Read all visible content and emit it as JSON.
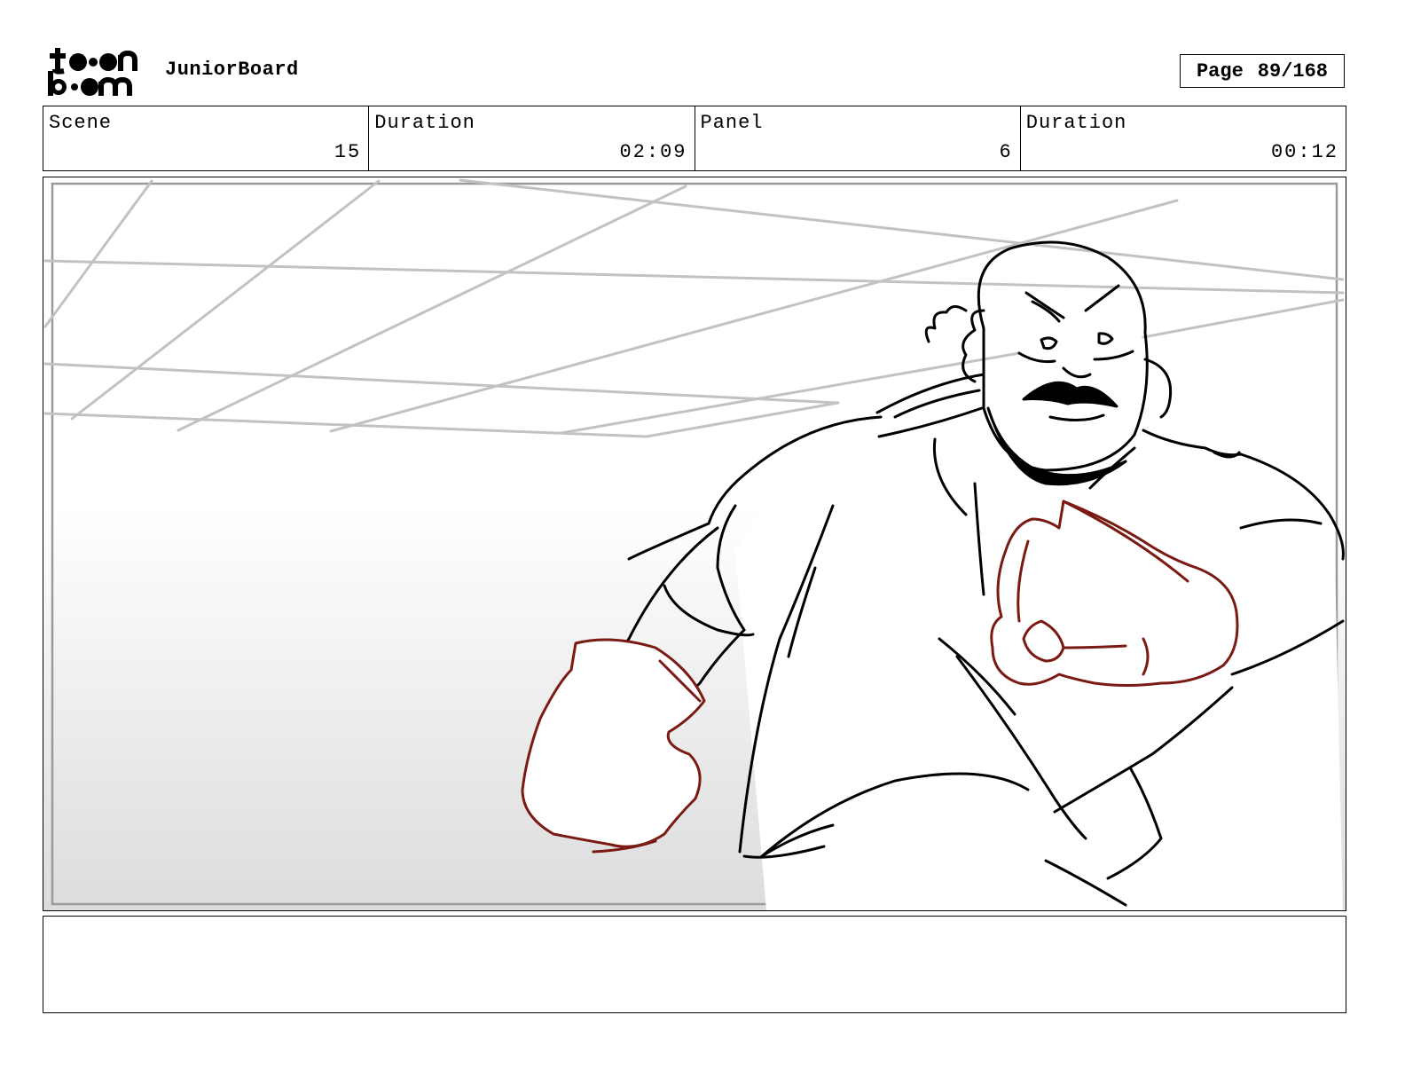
{
  "header": {
    "project_name": "JuniorBoard",
    "page_label": "Page",
    "page_value": "89/168"
  },
  "info": {
    "scene_label": "Scene",
    "scene_value": "15",
    "duration_label": "Duration",
    "duration_value": "02:09",
    "panel_label": "Panel",
    "panel_value": "6",
    "panel_duration_label": "Duration",
    "panel_duration_value": "00:12"
  },
  "notes": {
    "text": ""
  },
  "colors": {
    "sketch_line": "#000000",
    "glove_line": "#7a1a12",
    "background_line": "#bfbfbf"
  }
}
